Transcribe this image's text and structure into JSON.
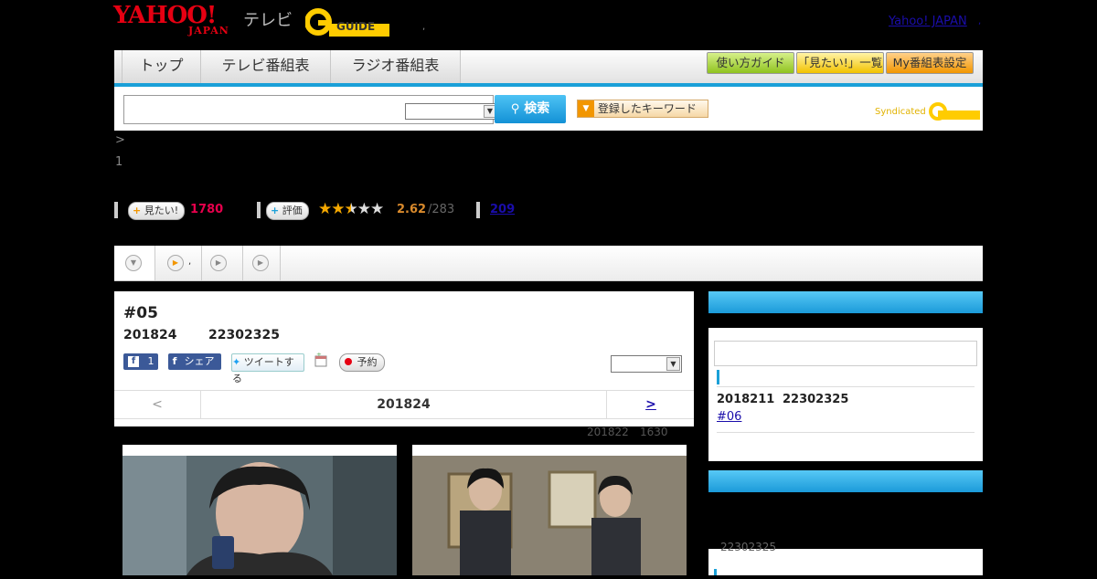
{
  "header": {
    "yahoo_logo": "YAHOO!",
    "japan_logo": "JAPAN",
    "tv_label": "テレビ",
    "guide_logo": "GUIDE",
    "yahoo_japan_link": "Yahoo! JAPAN",
    "comma": ","
  },
  "nav": {
    "tabs": [
      "トップ",
      "テレビ番組表",
      "ラジオ番組表"
    ],
    "guide_button": "使い方ガイド",
    "want_list_button": "「見たい!」一覧",
    "my_schedule_button": "My番組表設定"
  },
  "search": {
    "value": "",
    "select_value": "",
    "button_label": "検索",
    "keyword_button": "登録したキーワード",
    "syndicated": "Syndicated"
  },
  "breadcrumb": {
    "arrow": ">",
    "page_number": "1"
  },
  "ratings": {
    "want_label": "見たい!",
    "want_count": "1780",
    "eval_label": "評価",
    "score": "2.62",
    "reviews": "/283",
    "comment_count": "209",
    "stars_filled": 2.5,
    "star_color": "#f5a800",
    "want_color": "#e6004c",
    "score_color": "#d98a2c"
  },
  "program_tabs": {
    "tab2_label": ","
  },
  "episode": {
    "title": "#05",
    "date": "201824",
    "time": "22302325",
    "like_count": "1",
    "share_label": "シェア",
    "tweet_label": "ツイートする",
    "reserve_label": "予約",
    "select_value": "",
    "pager_prev": "<",
    "pager_current": "201824",
    "pager_next": ">",
    "update_date": "201822",
    "update_time": "1630"
  },
  "sidebar": {
    "next_date": "2018211",
    "next_time": "22302325",
    "next_episode_link": "#06",
    "second_panel_time": "22302325"
  }
}
